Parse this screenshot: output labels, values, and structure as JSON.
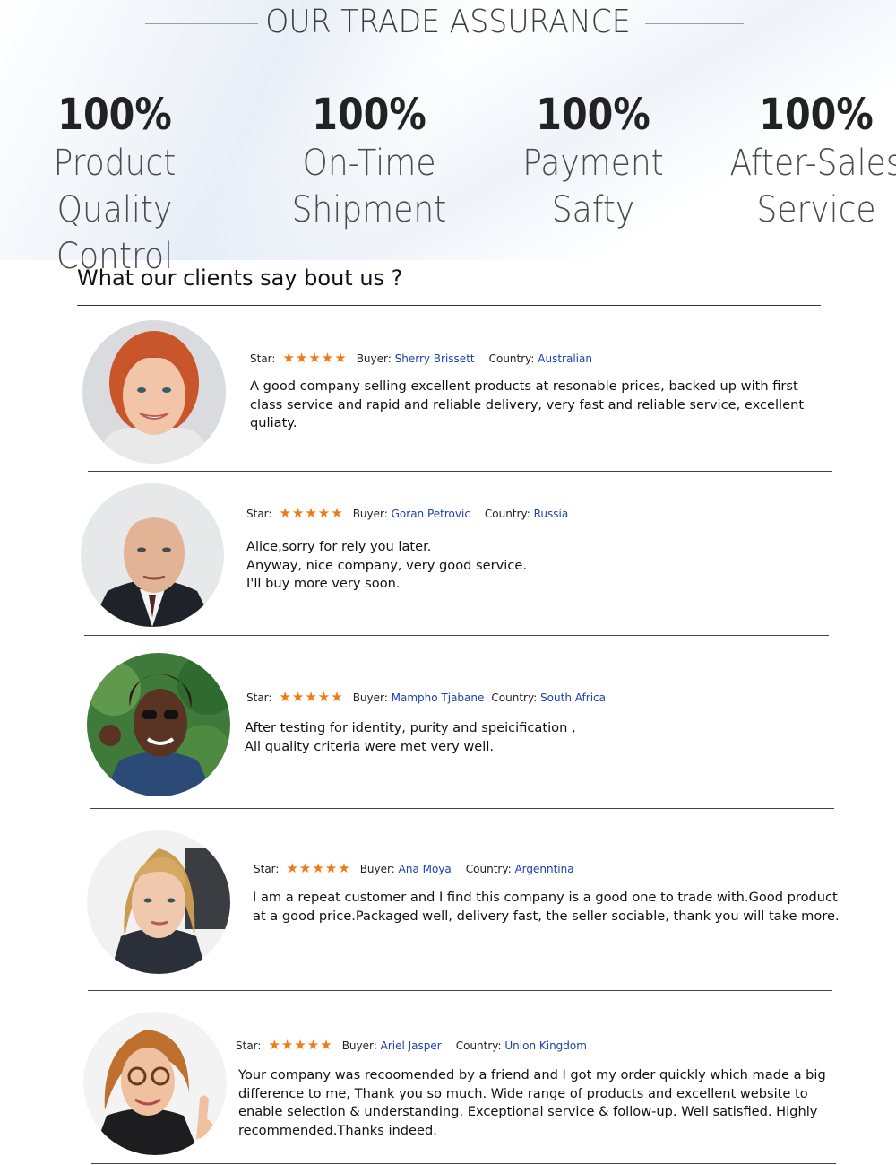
{
  "header": {
    "title": "OUR TRADE ASSURANCE"
  },
  "assurances": [
    {
      "percent": "100%",
      "line1": "Product Quality",
      "line2": "Control"
    },
    {
      "percent": "100%",
      "line1": "On-Time",
      "line2": "Shipment"
    },
    {
      "percent": "100%",
      "line1": "Payment",
      "line2": "Safty"
    },
    {
      "percent": "100%",
      "line1": "After-Sales",
      "line2": "Service"
    }
  ],
  "clients": {
    "heading": "What our clients say bout us ?",
    "star_label": "Star:",
    "buyer_label": "Buyer:",
    "country_label": "Country:",
    "stars": "★★★★★",
    "rating": 5,
    "reviews": [
      {
        "buyer": "Sherry Brissett",
        "country": "Australian",
        "lines": [
          "A good company selling excellent products at resonable prices, backed up with first",
          "class service and rapid and reliable delivery, very fast and reliable service, excellent",
          "quliaty."
        ]
      },
      {
        "buyer": "Goran Petrovic",
        "country": "Russia",
        "lines": [
          "Alice,sorry for rely you later.",
          "Anyway, nice company, very good service.",
          "I'll buy more very soon."
        ]
      },
      {
        "buyer": "Mampho Tjabane",
        "country": "South Africa",
        "lines": [
          "After testing for identity, purity and speicification ,",
          "All quality criteria were met very well."
        ]
      },
      {
        "buyer": "Ana Moya",
        "country": "Argenntina",
        "lines": [
          "I am a repeat customer and I find this company is a good one to trade with.Good product",
          "at a good price.Packaged well, delivery fast, the seller sociable, thank you will take more."
        ]
      },
      {
        "buyer": "Ariel Jasper",
        "country": "Union Kingdom",
        "lines": [
          "Your company was recoomended by a friend and I got my order quickly which made a big",
          "difference to me, Thank you so much. Wide range of products and excellent website to",
          "enable selection & understanding. Exceptional service & follow-up. Well satisfied. Highly",
          "recommended.Thanks indeed."
        ]
      }
    ]
  },
  "colors": {
    "star": "#f07a16",
    "link_blue": "#1b3fae"
  }
}
